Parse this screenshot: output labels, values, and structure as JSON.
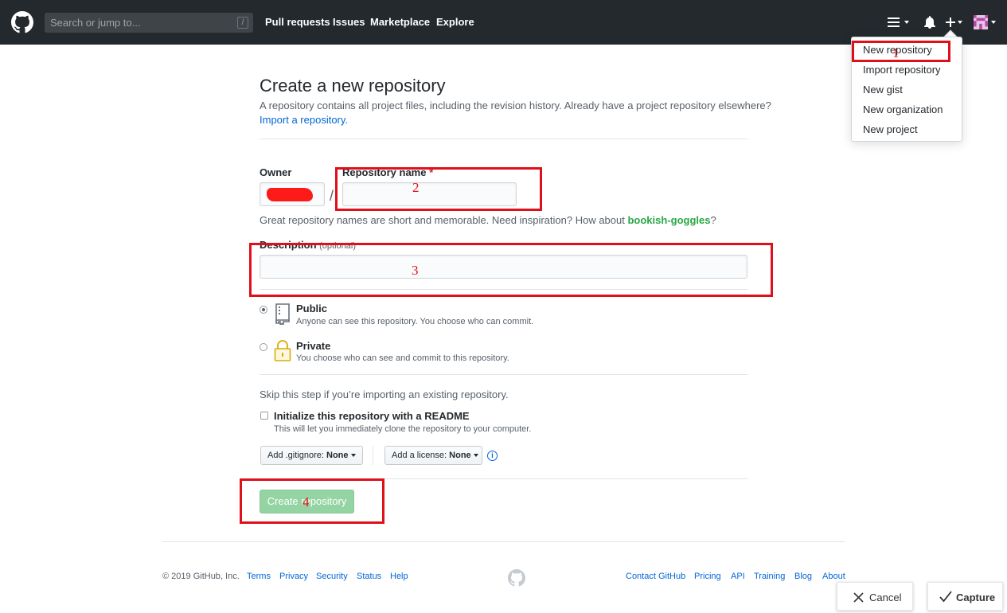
{
  "header": {
    "search_placeholder": "Search or jump to...",
    "search_shortcut": "/",
    "nav": [
      "Pull requests",
      "Issues",
      "Marketplace",
      "Explore"
    ],
    "plus_label": "+"
  },
  "dropdown": {
    "items": [
      "New repository",
      "Import repository",
      "New gist",
      "New organization",
      "New project"
    ]
  },
  "page": {
    "title": "Create a new repository",
    "subtitle": "A repository contains all project files, including the revision history. Already have a project repository elsewhere?",
    "import_link": "Import a repository.",
    "owner_label": "Owner",
    "repo_name_label": "Repository name",
    "required_mark": "*",
    "slash": "/",
    "hint_prefix": "Great repository names are short and memorable. Need inspiration? How about ",
    "hint_suggestion": "bookish-goggles",
    "hint_suffix": "?",
    "description_label": "Description",
    "description_optional": "(optional)",
    "visibility": {
      "public_title": "Public",
      "public_desc": "Anyone can see this repository. You choose who can commit.",
      "private_title": "Private",
      "private_desc": "You choose who can see and commit to this repository.",
      "selected": "Public"
    },
    "skip_text": "Skip this step if you’re importing an existing repository.",
    "readme_label": "Initialize this repository with a README",
    "readme_desc": "This will let you immediately clone the repository to your computer.",
    "gitignore_label": "Add .gitignore:",
    "gitignore_value": "None",
    "license_label": "Add a license:",
    "license_value": "None",
    "info_glyph": "i",
    "create_button": "Create repository"
  },
  "annotations": {
    "marks": [
      "1",
      "2",
      "3",
      "4"
    ],
    "color": "#e0101a"
  },
  "footer": {
    "copyright": "© 2019 GitHub, Inc.",
    "left_links": [
      "Terms",
      "Privacy",
      "Security",
      "Status",
      "Help"
    ],
    "right_links": [
      "Contact GitHub",
      "Pricing",
      "API",
      "Training",
      "Blog",
      "About"
    ]
  },
  "capture_toolbar": {
    "cancel_label": "Cancel",
    "capture_label": "Capture"
  },
  "colors": {
    "header_bg": "#24292e",
    "link": "#0366d6",
    "create_button_bg": "#94d3a2",
    "suggestion": "#28a745"
  }
}
